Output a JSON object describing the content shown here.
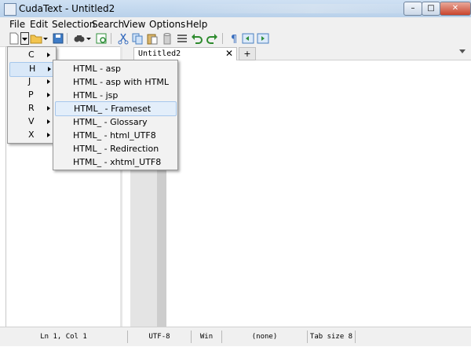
{
  "window": {
    "title": "CudaText - Untitled2",
    "min": "–",
    "max": "□",
    "close": "✕"
  },
  "menubar": {
    "items": [
      "File",
      "Edit",
      "Selection",
      "Search",
      "View",
      "Options",
      "Help"
    ]
  },
  "toolbar": {
    "icons": [
      "new-file-icon",
      "open-file-icon",
      "save-icon",
      "find-icon",
      "go-to-icon",
      "cut-icon",
      "copy-icon",
      "paste-icon",
      "delete-icon",
      "select-all-icon",
      "undo-icon",
      "redo-icon",
      "pilcrow-icon",
      "unindent-icon",
      "indent-icon"
    ]
  },
  "tabs": [
    {
      "label": "Untitled2",
      "close": "✕"
    }
  ],
  "tab_add": "+",
  "status": {
    "position": "Ln 1, Col 1",
    "encoding": "UTF-8",
    "line_ends": "Win",
    "lexer": "(none)",
    "tab_size": "Tab size 8"
  },
  "lexer_menu": {
    "groups": [
      "C",
      "H",
      "J",
      "P",
      "R",
      "V",
      "X"
    ],
    "selected_group": "H",
    "submenu": [
      "HTML - asp",
      "HTML - asp with HTML",
      "HTML - jsp",
      "HTML_ - Frameset",
      "HTML_ - Glossary",
      "HTML_ - html_UTF8",
      "HTML_ - Redirection",
      "HTML_ - xhtml_UTF8"
    ],
    "selected_item": "HTML_ - Frameset"
  },
  "colors": {
    "titlebar": "#c4d8ee",
    "menu_highlight": "#d9e8f8",
    "accent": "#a6c7ec"
  }
}
